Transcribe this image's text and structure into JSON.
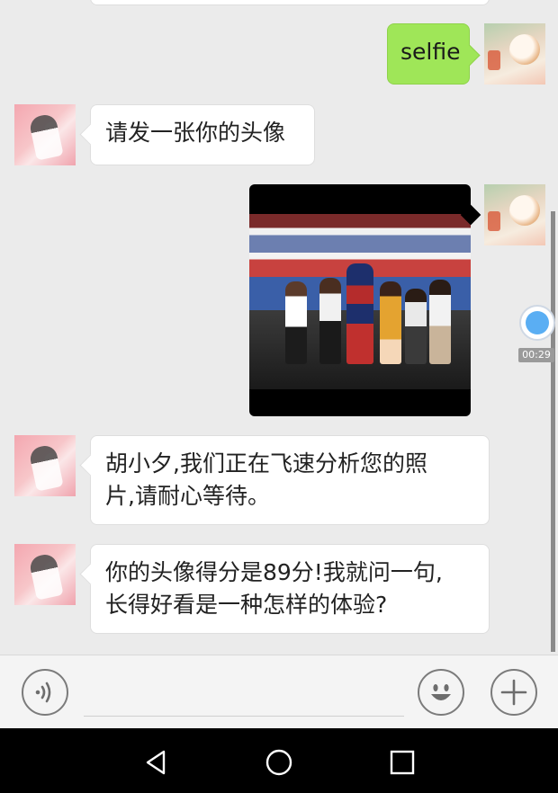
{
  "messages": [
    {
      "type": "text",
      "side": "right",
      "text": "selfie"
    },
    {
      "type": "text",
      "side": "left",
      "text": "请发一张你的头像"
    },
    {
      "type": "image",
      "side": "right"
    },
    {
      "type": "text",
      "side": "left",
      "lines": [
        "胡小夕,我们正在飞速分析您的照",
        "片,请耐心等待。"
      ]
    },
    {
      "type": "text",
      "side": "left",
      "lines": [
        "你的头像得分是89分!我就问一句,",
        "长得好看是一种怎样的体验?"
      ]
    }
  ],
  "scrollbar": {
    "time_label": "00:29"
  },
  "input_bar": {
    "voice_icon": "voice-wave-icon",
    "emoji_icon": "smiley-icon",
    "more_icon": "plus-icon"
  },
  "nav_bar": {
    "back_icon": "triangle-back-icon",
    "home_icon": "circle-home-icon",
    "recents_icon": "square-recents-icon"
  },
  "colors": {
    "sent_bubble": "#9fe658",
    "received_bubble": "#ffffff",
    "background": "#ebebeb",
    "scroll_dot": "#5aaef3"
  }
}
